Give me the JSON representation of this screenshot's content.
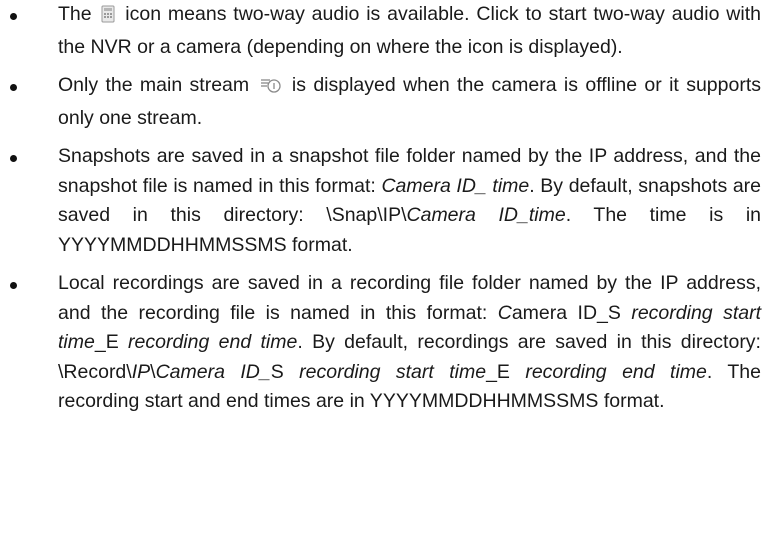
{
  "notes": [
    {
      "parts": [
        {
          "t": "The "
        },
        {
          "icon": "two-way-audio-icon"
        },
        {
          "t": " icon means two-way audio is available. Click to start two-way audio with the NVR or a camera (depending on where the icon is displayed)."
        }
      ]
    },
    {
      "parts": [
        {
          "t": "Only the main stream "
        },
        {
          "icon": "main-stream-icon"
        },
        {
          "t": " is displayed when the camera is offline or it supports only one stream."
        }
      ]
    },
    {
      "parts": [
        {
          "t": "Snapshots are saved in a snapshot file folder named by the IP address, and the snapshot file is named in this format: "
        },
        {
          "i": "Camera ID_ time"
        },
        {
          "t": ". By default, snapshots are saved in this directory: \\Snap\\IP\\"
        },
        {
          "i": "Camera ID_time"
        },
        {
          "t": ". The time is in YYYYMMDDHHMMSSMS format."
        }
      ]
    },
    {
      "parts": [
        {
          "t": "Local recordings are saved in a recording file folder named by the IP address, and the recording file is named in this format: "
        },
        {
          "i": "C"
        },
        {
          "t": "amera ID_S "
        },
        {
          "i": "recording start time"
        },
        {
          "t": "_E "
        },
        {
          "i": "recording end time"
        },
        {
          "t": ". By default, recordings are saved in this directory: \\Record\\"
        },
        {
          "i": "IP"
        },
        {
          "t": "\\"
        },
        {
          "i": "Camera ID_"
        },
        {
          "t": "S "
        },
        {
          "i": "recording start time"
        },
        {
          "t": "_E "
        },
        {
          "i": "recording end time"
        },
        {
          "t": ". The recording start and end times are in YYYYMMDDHHMMSSMS format."
        }
      ]
    }
  ]
}
